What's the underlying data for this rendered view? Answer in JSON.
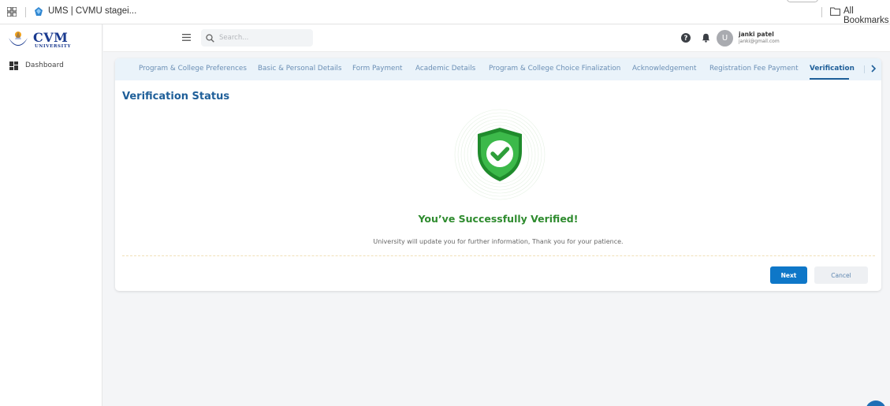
{
  "browser": {
    "site_tab_label": "UMS | CVMU stagei...",
    "all_bookmarks_label": "All Bookmarks",
    "icons": {
      "apps": "apps-grid-icon",
      "site": "site-favicon-icon",
      "folder": "folder-icon"
    }
  },
  "sidebar": {
    "logo_text": "CVM",
    "logo_subtext": "UNIVERSITY",
    "items": [
      {
        "label": "Dashboard",
        "icon": "dashboard-icon"
      }
    ]
  },
  "header": {
    "search_placeholder": "Search...",
    "user_initial": "U",
    "user_name": "janki patel",
    "user_email": "janki@gmail.com",
    "icons": {
      "menu": "hamburger-icon",
      "search": "search-icon",
      "help": "help-icon",
      "notifications": "bell-icon"
    }
  },
  "tabs": [
    {
      "label": "Program & College Preferences",
      "active": false
    },
    {
      "label": "Basic & Personal Details",
      "active": false
    },
    {
      "label": "Form Payment",
      "active": false
    },
    {
      "label": "Academic Details",
      "active": false
    },
    {
      "label": "Program & College Choice Finalization",
      "active": false
    },
    {
      "label": "Acknowledgement",
      "active": false
    },
    {
      "label": "Registration Fee Payment",
      "active": false
    },
    {
      "label": "Verification",
      "active": true
    }
  ],
  "main": {
    "title": "Verification Status",
    "success_title": "You’ve Successfully Verified!",
    "success_message": "University will update you for further information, Thank you for your patience.",
    "next_label": "Next",
    "cancel_label": "Cancel"
  },
  "colors": {
    "primary": "#1f5f99",
    "success": "#2e8b2e",
    "button_primary": "#0e77c8",
    "tab_bg": "#eaf3fa"
  }
}
